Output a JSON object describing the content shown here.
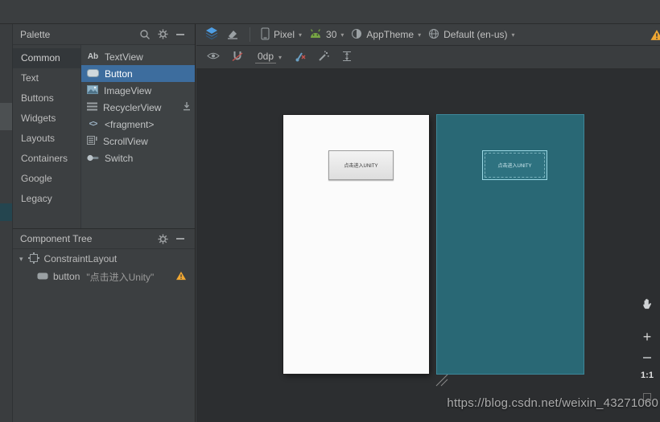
{
  "top_toolbar": {
    "device": {
      "label": "Pixel"
    },
    "api": {
      "label": "30"
    },
    "theme": {
      "label": "AppTheme"
    },
    "locale": {
      "label": "Default (en-us)"
    }
  },
  "design_toolbar": {
    "margin": "0dp"
  },
  "palette": {
    "title": "Palette",
    "categories": [
      {
        "label": "Common"
      },
      {
        "label": "Text"
      },
      {
        "label": "Buttons"
      },
      {
        "label": "Widgets"
      },
      {
        "label": "Layouts"
      },
      {
        "label": "Containers"
      },
      {
        "label": "Google"
      },
      {
        "label": "Legacy"
      }
    ],
    "items": [
      {
        "icon": "Ab",
        "label": "TextView"
      },
      {
        "label": "Button"
      },
      {
        "label": "ImageView"
      },
      {
        "label": "RecyclerView"
      },
      {
        "icon": "<>",
        "label": "<fragment>"
      },
      {
        "label": "ScrollView"
      },
      {
        "label": "Switch"
      }
    ]
  },
  "component_tree": {
    "title": "Component Tree",
    "root_label": "ConstraintLayout",
    "child_label": "button",
    "child_text": "\"点击进入Unity\""
  },
  "canvas": {
    "design_button_text": "点击进入UNITY",
    "blueprint_button_text": "点击进入UNITY"
  },
  "zoom_controls": {
    "plus": "+",
    "zoom_label": "1:1"
  },
  "watermark": "https://blog.csdn.net/weixin_43271060",
  "colors": {
    "selection_blue": "#3d6d9e",
    "blueprint_teal": "#296875",
    "warning_orange": "#f0a732",
    "android_green": "#77a644",
    "layers_blue": "#4f9ee3"
  }
}
